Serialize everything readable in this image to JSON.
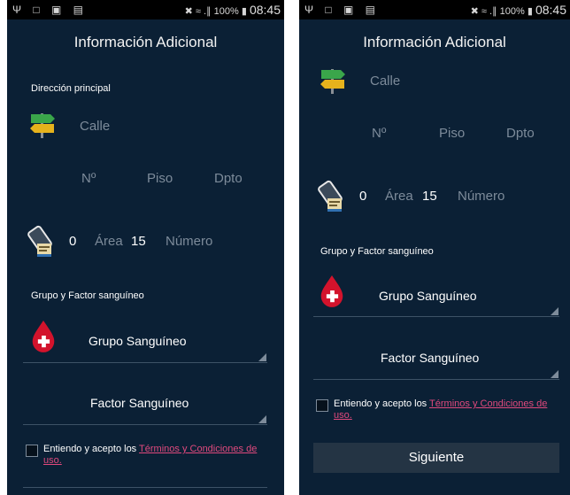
{
  "status": {
    "left_icons": "Ψ □ ▣ ▤",
    "right_icons": "✖ ≈ .∥",
    "battery": "100%",
    "time": "08:45"
  },
  "header": {
    "title": "Información Adicional"
  },
  "address": {
    "section_label": "Dirección principal",
    "street_placeholder": "Calle",
    "number_placeholder": "Nº",
    "floor_placeholder": "Piso",
    "apartment_placeholder": "Dpto"
  },
  "phone": {
    "prefix": "0",
    "area_label": "Área",
    "area_code": "15",
    "number_placeholder": "Número"
  },
  "blood": {
    "section_label": "Grupo y Factor sanguíneo",
    "group_label": "Grupo Sanguíneo",
    "factor_label": "Factor Sanguíneo"
  },
  "terms": {
    "prefix": "Entiendo y acepto los ",
    "link": "Términos y Condiciones de uso."
  },
  "next_button": "Siguiente",
  "icons": {
    "signpost": "signpost-icon",
    "phone": "phone-icon",
    "blood_drop": "blood-drop-icon"
  },
  "colors": {
    "background": "#0b2035",
    "status_bar": "#000000",
    "link": "#e0497d",
    "button": "#243444",
    "hint_text": "#7d8b9a"
  }
}
